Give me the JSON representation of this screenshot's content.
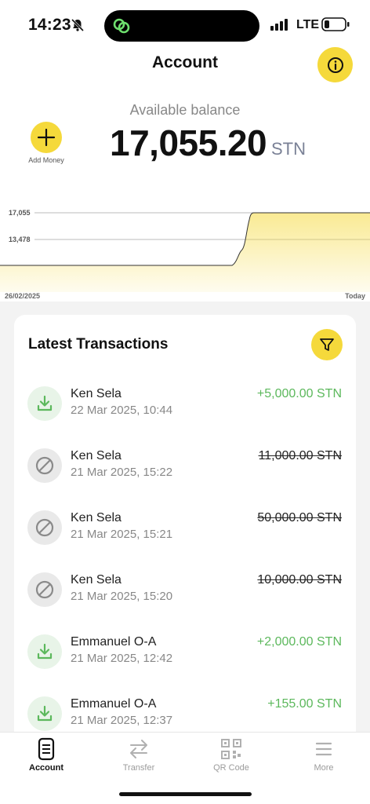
{
  "status_bar": {
    "time": "14:23",
    "network": "LTE"
  },
  "header": {
    "title": "Account",
    "info_icon": "info-icon"
  },
  "balance": {
    "label": "Available balance",
    "amount": "17,055.20",
    "currency": "STN",
    "add_money_label": "Add Money"
  },
  "chart_data": {
    "type": "area",
    "y_ticks": [
      "17,055",
      "13,478"
    ],
    "x_start_label": "26/02/2025",
    "x_end_label": "Today",
    "accent_color": "#f5d93b"
  },
  "transactions": {
    "title": "Latest Transactions",
    "filter_icon": "filter-icon",
    "items": [
      {
        "name": "Ken Sela",
        "date": "22 Mar 2025, 10:44",
        "amount": "+5,000.00 STN",
        "status": "received"
      },
      {
        "name": "Ken Sela",
        "date": "21 Mar 2025, 15:22",
        "amount": "11,000.00 STN",
        "status": "cancelled"
      },
      {
        "name": "Ken Sela",
        "date": "21 Mar 2025, 15:21",
        "amount": "50,000.00 STN",
        "status": "cancelled"
      },
      {
        "name": "Ken Sela",
        "date": "21 Mar 2025, 15:20",
        "amount": "10,000.00 STN",
        "status": "cancelled"
      },
      {
        "name": "Emmanuel O-A",
        "date": "21 Mar 2025, 12:42",
        "amount": "+2,000.00 STN",
        "status": "received"
      },
      {
        "name": "Emmanuel O-A",
        "date": "21 Mar 2025, 12:37",
        "amount": "+155.00 STN",
        "status": "received"
      }
    ]
  },
  "tab_bar": {
    "tabs": [
      {
        "label": "Account",
        "icon": "account-icon",
        "active": true
      },
      {
        "label": "Transfer",
        "icon": "transfer-icon",
        "active": false
      },
      {
        "label": "QR Code",
        "icon": "qr-code-icon",
        "active": false
      },
      {
        "label": "More",
        "icon": "menu-icon",
        "active": false
      }
    ]
  }
}
